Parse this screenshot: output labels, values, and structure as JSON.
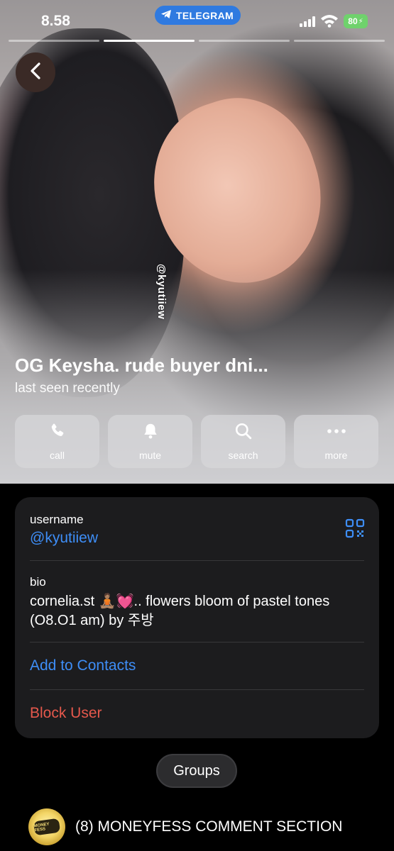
{
  "status_bar": {
    "time": "8.58",
    "app_pill": "TELEGRAM",
    "battery": "80"
  },
  "profile": {
    "watermark": "@kyutiiew",
    "name": "OG Keysha. rude buyer dni...",
    "last_seen": "last seen recently"
  },
  "actions": [
    {
      "label": "call",
      "icon": "phone-icon"
    },
    {
      "label": "mute",
      "icon": "bell-icon"
    },
    {
      "label": "search",
      "icon": "search-icon"
    },
    {
      "label": "more",
      "icon": "more-icon"
    }
  ],
  "info": {
    "username_label": "username",
    "username_value": "@kyutiiew",
    "bio_label": "bio",
    "bio_value": "cornelia.st 🧘🏽💓.. flowers bloom of pastel tones (O8.O1 am) by 주방",
    "add_contacts": "Add to Contacts",
    "block_user": "Block User"
  },
  "tabs": {
    "groups": "Groups"
  },
  "groups": [
    {
      "name": "(8) MONEYFESS COMMENT SECTION",
      "avatar_text": "MONEY FESS"
    }
  ],
  "colors": {
    "accent_blue": "#3e8ef7",
    "destructive_red": "#e5584c",
    "telegram_pill": "#2f7ae0",
    "battery_green": "#6fd26c"
  }
}
